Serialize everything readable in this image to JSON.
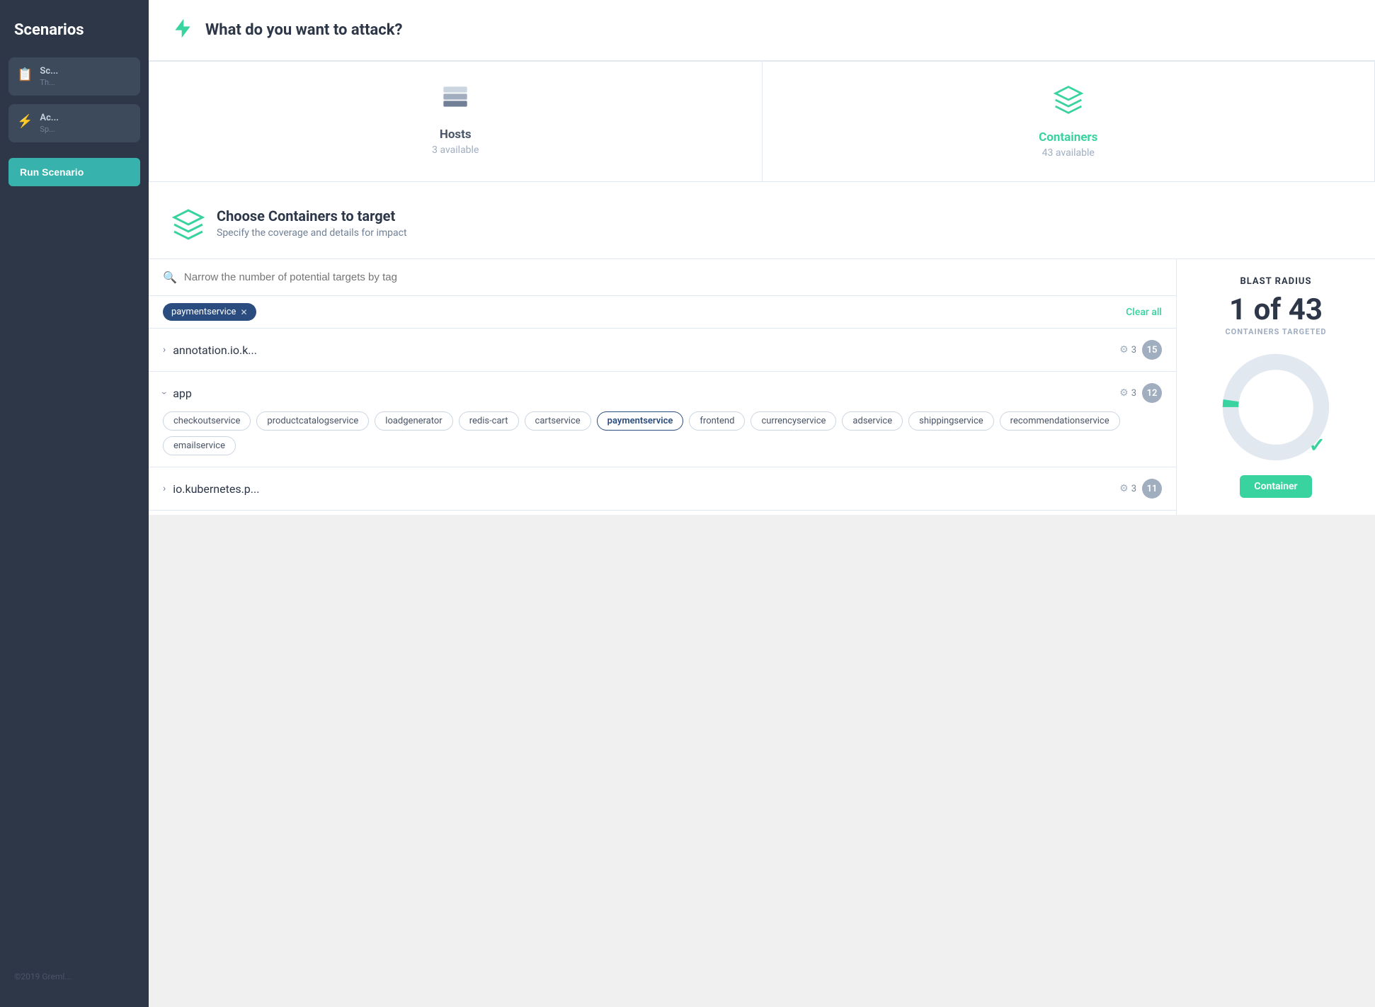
{
  "sidebar": {
    "title": "Scenarios",
    "cards": [
      {
        "icon": "📋",
        "icon_class": "normal",
        "title": "Sc...",
        "sub": "Th..."
      },
      {
        "icon": "⚡",
        "icon_class": "green",
        "title": "Ac...",
        "sub": "Sp..."
      }
    ],
    "run_button": "Run Scenario",
    "footer": "©2019 Greml..."
  },
  "header": {
    "title": "What do you want to attack?",
    "icon": "⚡"
  },
  "target_types": [
    {
      "icon": "layers",
      "icon_class": "normal",
      "title": "Hosts",
      "subtitle": "3 available"
    },
    {
      "icon": "cube",
      "icon_class": "green",
      "title": "Containers",
      "subtitle": "43 available"
    }
  ],
  "choose_section": {
    "title": "Choose Containers to target",
    "subtitle": "Specify the coverage and details for impact"
  },
  "search": {
    "placeholder": "Narrow the number of potential targets by tag"
  },
  "active_tags": [
    {
      "label": "paymentservice"
    }
  ],
  "clear_all_label": "Clear all",
  "list_rows": [
    {
      "name": "annotation.io.k...",
      "expanded": false,
      "gear_count": 3,
      "container_count": "15",
      "sub_tags": []
    },
    {
      "name": "app",
      "expanded": true,
      "gear_count": 3,
      "container_count": "12",
      "sub_tags": [
        {
          "label": "checkoutservice",
          "active": false
        },
        {
          "label": "productcatalogservice",
          "active": false
        },
        {
          "label": "loadgenerator",
          "active": false
        },
        {
          "label": "redis-cart",
          "active": false
        },
        {
          "label": "cartservice",
          "active": false
        },
        {
          "label": "paymentservice",
          "active": true
        },
        {
          "label": "frontend",
          "active": false
        },
        {
          "label": "currencyservice",
          "active": false
        },
        {
          "label": "adservice",
          "active": false
        },
        {
          "label": "shippingservice",
          "active": false
        },
        {
          "label": "recommendationservice",
          "active": false
        },
        {
          "label": "emailservice",
          "active": false
        }
      ]
    },
    {
      "name": "io.kubernetes.p...",
      "expanded": false,
      "gear_count": 3,
      "container_count": "11",
      "sub_tags": []
    }
  ],
  "blast_radius": {
    "title": "BLAST RADIUS",
    "count": "1 of 43",
    "label": "CONTAINERS TARGETED",
    "donut": {
      "total": 43,
      "selected": 1,
      "bg_color": "#e2e8f0",
      "fg_color": "#38d39f"
    },
    "badge_label": "Container"
  },
  "colors": {
    "green": "#38d39f",
    "dark_blue": "#2b4c7e",
    "gray": "#a0aec0"
  }
}
